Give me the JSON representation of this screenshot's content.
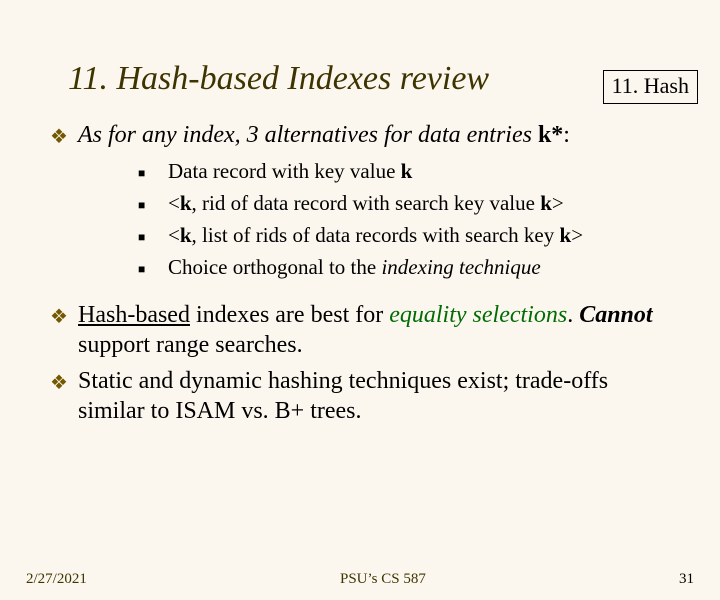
{
  "topic_tag": "11. Hash",
  "title": "11. Hash-based Indexes review",
  "points": {
    "p1_lead": "As for any index, 3 alternatives for data entries ",
    "p1_bold": "k*",
    "p1_tail": ":",
    "sub1_a": " Data record with key value ",
    "sub1_b": "k",
    "sub2_a": " <",
    "sub2_b": "k",
    "sub2_c": ", rid of data record with search key value ",
    "sub2_d": "k",
    "sub2_e": ">",
    "sub3_a": " <",
    "sub3_b": "k",
    "sub3_c": ", list of rids of data records with search key ",
    "sub3_d": "k",
    "sub3_e": ">",
    "sub4_a": "Choice orthogonal to the ",
    "sub4_b": "indexing technique",
    "p2_a": "Hash-based",
    "p2_b": " indexes are best for ",
    "p2_c": "equality selections",
    "p2_d": ". ",
    "p2_e": "Cannot",
    "p2_f": " support range searches.",
    "p3": "Static and dynamic hashing techniques exist; trade-offs similar to ISAM vs. B+ trees."
  },
  "footer": {
    "date": "2/27/2021",
    "mid": "PSU’s CS 587",
    "page": "31"
  },
  "glyphs": {
    "diamond": "❖",
    "square": "■"
  }
}
